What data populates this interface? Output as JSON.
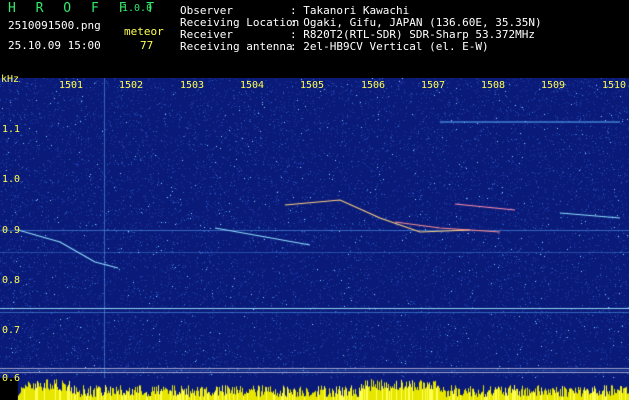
{
  "app": {
    "name": "H R O F F T",
    "version": "1.0.0"
  },
  "file": {
    "name": "2510091500.png",
    "datetime": "25.10.09 15:00"
  },
  "meteor": {
    "label": "meteor",
    "count": "77"
  },
  "info": [
    {
      "key": "Observer",
      "value": ": Takanori Kawachi"
    },
    {
      "key": "Receiving Location",
      "value": ": Ogaki, Gifu, JAPAN (136.60E, 35.35N)"
    },
    {
      "key": "Receiver",
      "value": ": R820T2(RTL-SDR) SDR-Sharp 53.372MHz"
    },
    {
      "key": "Receiving antenna",
      "value": ": 2el-HB9CV Vertical (el. E-W)"
    }
  ],
  "axis": {
    "y_unit": "kHz",
    "x_ticks": [
      "1501",
      "1502",
      "1503",
      "1504",
      "1505",
      "1506",
      "1507",
      "1508",
      "1509",
      "1510"
    ],
    "y_ticks": [
      "1.1",
      "1.0",
      "0.9",
      "0.8",
      "0.7",
      "0.6"
    ]
  },
  "colors": {
    "background": "#0a1a78",
    "accent": "#ffff50",
    "title": "#34e86a"
  }
}
